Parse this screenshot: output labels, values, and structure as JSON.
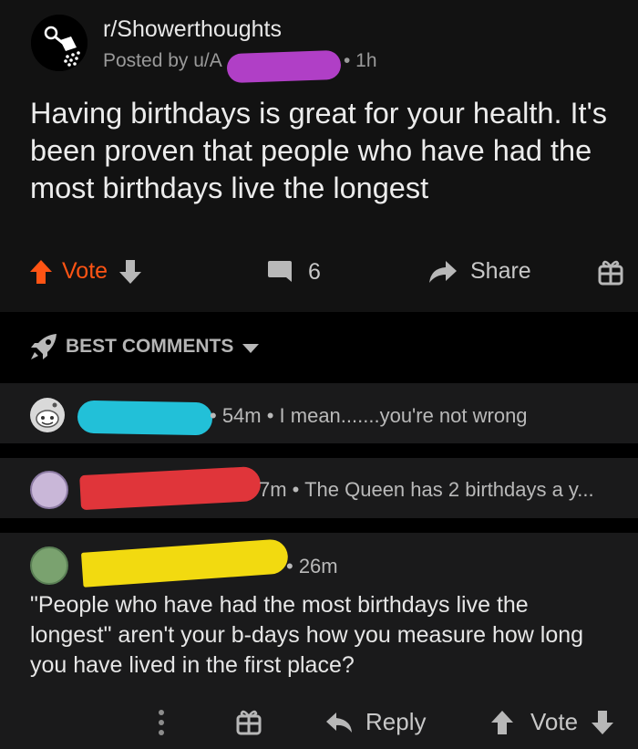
{
  "post": {
    "subreddit": "r/Showerthoughts",
    "posted_by": "Posted by u/A",
    "time": "• 1h",
    "title": "Having birthdays is great for your health. It's been proven that people who have had the most birthdays live the longest"
  },
  "actions": {
    "vote_label": "Vote",
    "comment_count": "6",
    "share_label": "Share"
  },
  "comments_header": {
    "sort_label": "BEST COMMENTS"
  },
  "comments": [
    {
      "meta": "• 54m • I mean.......you're not wrong"
    },
    {
      "meta": "7m • The Queen has 2 birthdays a y..."
    },
    {
      "meta": "• 26m",
      "body": [
        "\"People who have had the most birthdays live the",
        "longest\" aren't your b-days how you measure how long",
        "you have lived in the first place?"
      ]
    }
  ],
  "comment_actions": {
    "reply_label": "Reply",
    "vote_label": "Vote"
  },
  "colors": {
    "background": "#121212",
    "upvote_orange": "#ff5414",
    "redaction_purple": "#b03fc6",
    "redaction_cyan": "#22c0d8",
    "redaction_red": "#e0353a",
    "redaction_yellow": "#f2da10"
  },
  "icons": [
    "subreddit-avatar",
    "upvote-icon",
    "downvote-icon",
    "comment-icon",
    "share-icon",
    "award-icon",
    "rocket-icon",
    "chevron-down-icon",
    "more-icon",
    "reply-icon"
  ]
}
